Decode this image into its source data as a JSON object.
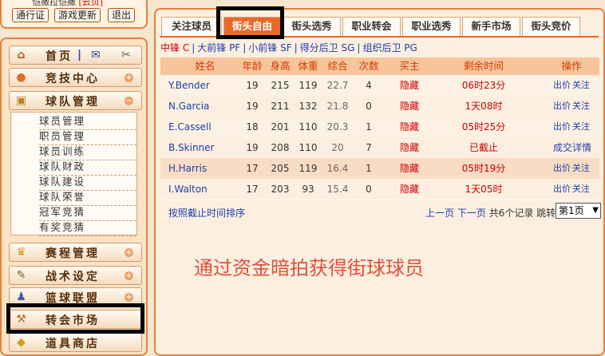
{
  "top": {
    "status_text": "恺撒拉恺撒",
    "status_user": "[云页]",
    "buttons": [
      "通行证",
      "游戏更新",
      "退出"
    ]
  },
  "sidebar": {
    "home": "首页",
    "home_sep": "|",
    "items": [
      {
        "label": "竞技中心",
        "icon": "basketball-icon",
        "toggle": "+"
      },
      {
        "label": "球队管理",
        "icon": "shirt-icon",
        "toggle": "−"
      },
      {
        "label": "赛程管理",
        "icon": "trophy-icon",
        "toggle": "+"
      },
      {
        "label": "战术设定",
        "icon": "tactics-icon",
        "toggle": "+"
      },
      {
        "label": "篮球联盟",
        "icon": "league-icon",
        "toggle": "+"
      },
      {
        "label": "转会市场",
        "icon": "hammer-icon",
        "toggle": ""
      },
      {
        "label": "道具商店",
        "icon": "shop-icon",
        "toggle": ""
      }
    ],
    "submenu": [
      "球员管理",
      "职员管理",
      "球员训练",
      "球队财政",
      "球队建设",
      "球队荣誉",
      "冠军竞猜",
      "有奖竞猜"
    ]
  },
  "tabs": [
    "关注球员",
    "街头自由",
    "街头选秀",
    "职业转会",
    "职业选秀",
    "新手市场",
    "街头竞价"
  ],
  "active_tab": "街头自由",
  "filter": {
    "selected": "中锋 C",
    "options": [
      "大前锋 PF",
      "小前锋 SF",
      "得分后卫 SG",
      "组织后卫 PG"
    ]
  },
  "table": {
    "headers": [
      "姓名",
      "年龄",
      "身高",
      "体重",
      "综合",
      "次数",
      "买主",
      "剩余时间",
      "操作"
    ],
    "rows": [
      {
        "name": "Y.Bender",
        "age": "19",
        "height": "215",
        "weight": "119",
        "overall": "22.7",
        "count": "4",
        "buyer": "隐藏",
        "time": "06时23分",
        "action1": "出价",
        "action2": "关注"
      },
      {
        "name": "N.Garcia",
        "age": "19",
        "height": "211",
        "weight": "132",
        "overall": "21.8",
        "count": "0",
        "buyer": "隐藏",
        "time": "1天08时",
        "action1": "出价",
        "action2": "关注"
      },
      {
        "name": "E.Cassell",
        "age": "18",
        "height": "201",
        "weight": "110",
        "overall": "20.3",
        "count": "1",
        "buyer": "隐藏",
        "time": "05时25分",
        "action1": "出价",
        "action2": "关注"
      },
      {
        "name": "B.Skinner",
        "age": "19",
        "height": "208",
        "weight": "110",
        "overall": "20",
        "count": "7",
        "buyer": "隐藏",
        "time": "已截止",
        "action1": "成交详情",
        "action2": ""
      },
      {
        "name": "H.Harris",
        "age": "17",
        "height": "205",
        "weight": "119",
        "overall": "16.4",
        "count": "1",
        "buyer": "隐藏",
        "time": "05时19分",
        "action1": "出价",
        "action2": "关注"
      },
      {
        "name": "I.Walton",
        "age": "17",
        "height": "203",
        "weight": "93",
        "overall": "15.4",
        "count": "0",
        "buyer": "隐藏",
        "time": "1天05时",
        "action1": "出价",
        "action2": "关注"
      }
    ]
  },
  "footer": {
    "sort_link": "按照截止时间排序",
    "prev": "上一页",
    "next": "下一页",
    "summary": "共6个记录",
    "jump": "跳转",
    "page_select": "第1页"
  },
  "caption": "通过资金暗拍获得街球球员",
  "colors": {
    "accent": "#e8692a",
    "link": "#1e3fae",
    "header_text": "#d03a00",
    "caption": "#e0503a"
  }
}
